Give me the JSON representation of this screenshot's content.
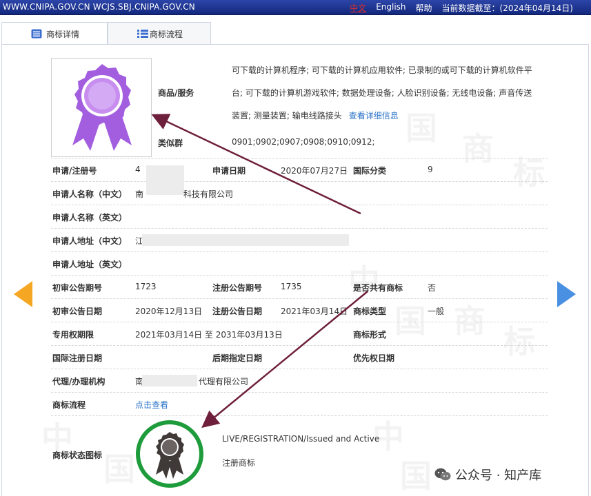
{
  "topbar": {
    "urls": "WWW.CNIPA.GOV.CN WCJS.SBJ.CNIPA.GOV.CN",
    "lang_cn": "中文",
    "lang_en": "English",
    "help": "帮助",
    "data_date": "当前数据截至：(2024年04月14日)"
  },
  "tabs": [
    {
      "label": "商标详情",
      "icon": "document-icon"
    },
    {
      "label": "商标流程",
      "icon": "list-icon"
    }
  ],
  "goods": {
    "label": "商品/服务",
    "text": "可下载的计算机程序; 可下载的计算机应用软件; 已录制的或可下载的计算机软件平台; 可下载的计算机游戏软件; 数据处理设备; 人脸识别设备; 无线电设备; 声音传送装置; 测量装置; 输电线路接头",
    "detail_link": "查看详细信息"
  },
  "similar": {
    "label": "类似群",
    "value": "0901;0902;0907;0908;0910;0912;"
  },
  "rows": {
    "app_no_label": "申请/注册号",
    "app_no_value": "4",
    "app_date_label": "申请日期",
    "app_date_value": "2020年07月27日",
    "intl_class_label": "国际分类",
    "intl_class_value": "9",
    "applicant_cn_label": "申请人名称（中文）",
    "applicant_cn_value_a": "南",
    "applicant_cn_value_b": "科技有限公司",
    "applicant_en_label": "申请人名称（英文）",
    "address_cn_label": "申请人地址（中文）",
    "address_cn_value": "江",
    "address_en_label": "申请人地址（英文）",
    "prelim_no_label": "初审公告期号",
    "prelim_no_value": "1723",
    "reg_no_label": "注册公告期号",
    "reg_no_value": "1735",
    "shared_label": "是否共有商标",
    "shared_value": "否",
    "prelim_date_label": "初审公告日期",
    "prelim_date_value": "2020年12月13日",
    "reg_date_label": "注册公告日期",
    "reg_date_value": "2021年03月14日",
    "type_label": "商标类型",
    "type_value": "一般",
    "term_label": "专用权期限",
    "term_value": "2021年03月14日 至 2031年03月13日",
    "form_label": "商标形式",
    "intl_reg_date_label": "国际注册日期",
    "later_designation_label": "后期指定日期",
    "priority_date_label": "优先权日期",
    "agent_label": "代理/办理机构",
    "agent_value_a": "南",
    "agent_value_b": "代理有限公司",
    "process_label": "商标流程",
    "process_link": "点击查看",
    "status_label": "商标状态图标",
    "status_en": "LIVE/REGISTRATION/Issued and Active",
    "status_cn": "注册商标"
  },
  "watermark": {
    "chars": [
      "中",
      "国",
      "商",
      "标"
    ]
  },
  "footer": {
    "wechat": "公众号 · 知产库"
  },
  "colors": {
    "topbar": "#1f3a9c",
    "link": "#2b74c8",
    "arrow_left": "#f5a623",
    "arrow_right": "#4a90e2",
    "pointer_arrow": "#6e1f3c",
    "logo_purple": "#a35ee0",
    "status_ring": "#1e9b3a"
  }
}
